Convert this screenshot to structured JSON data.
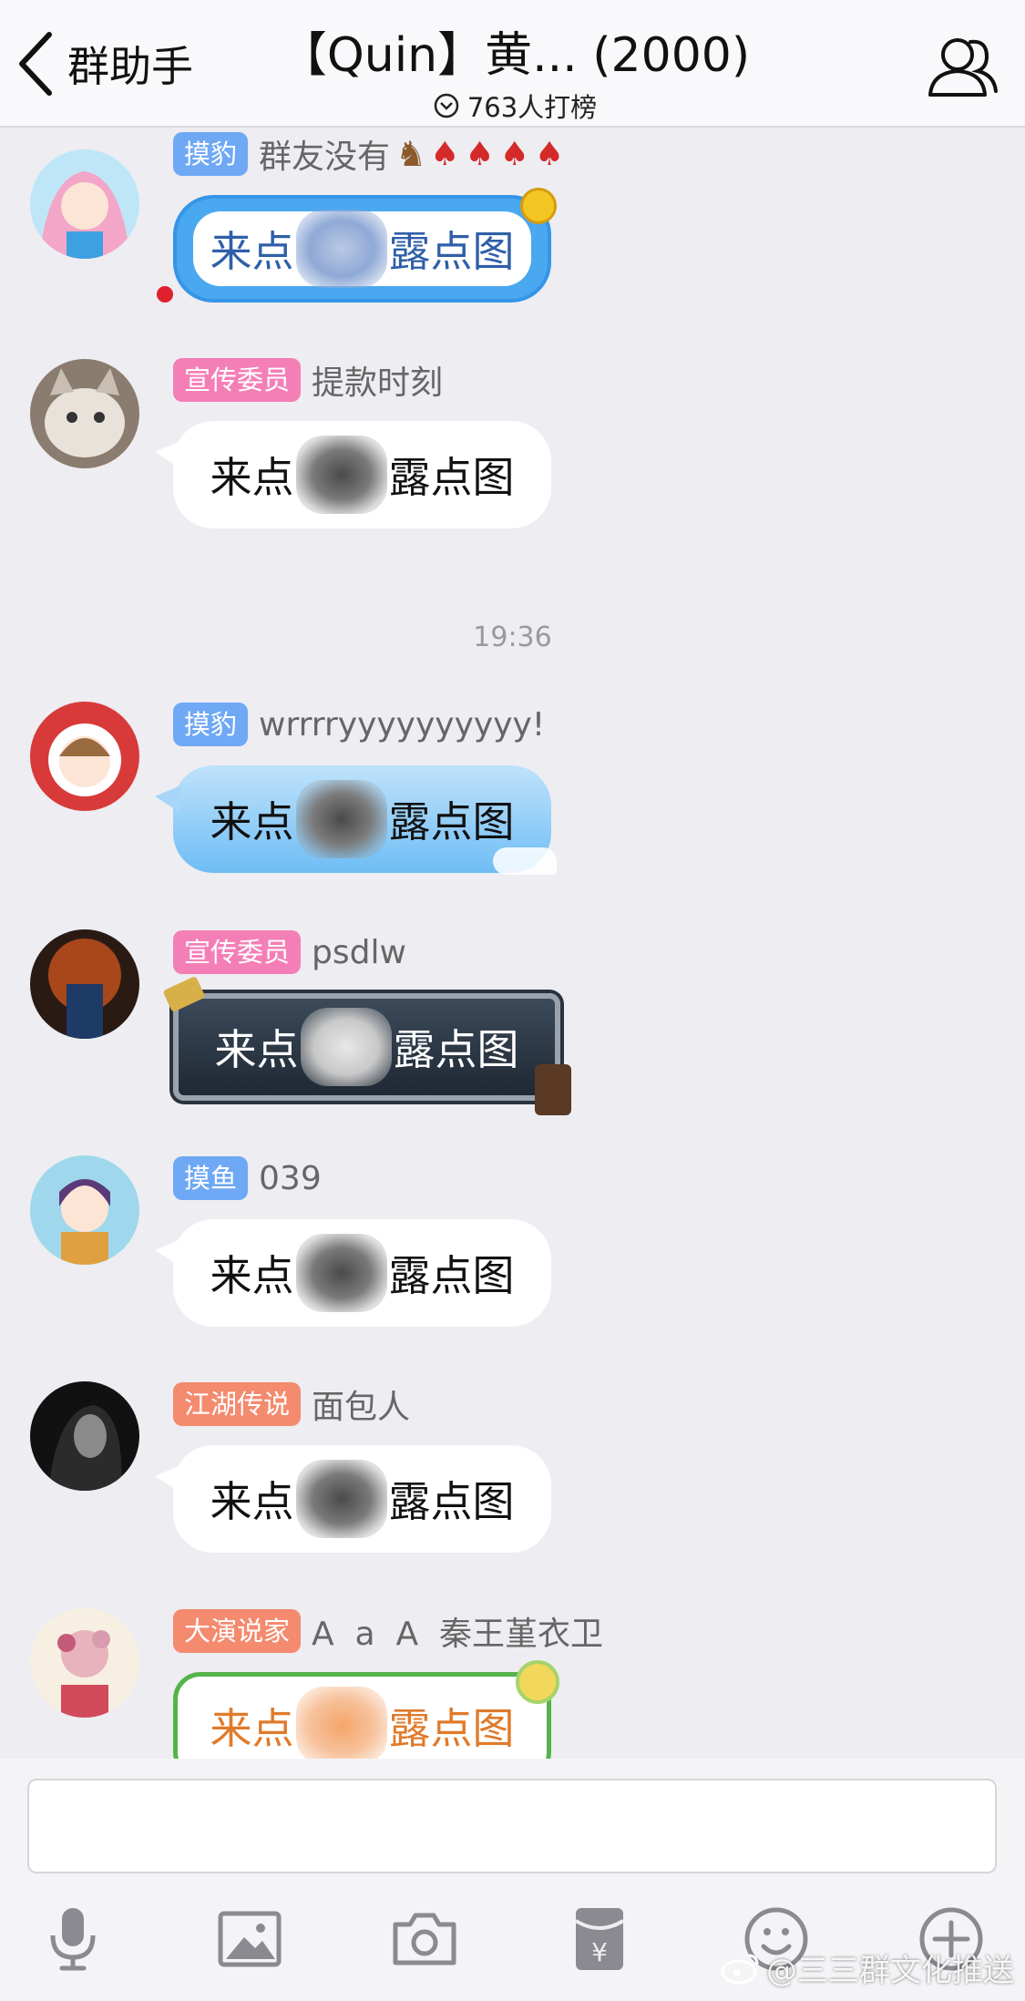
{
  "header": {
    "back_label": "群助手",
    "title": "【Quin】黄... (2000)",
    "subtitle": "763人打榜"
  },
  "chat": {
    "timestamp": "19:36",
    "messages": [
      {
        "badge": "摸豹",
        "badge_color": "#6fa8f5",
        "nick": "群友没有",
        "bubble": {
          "before": "来点",
          "after": "露点图"
        }
      },
      {
        "badge": "宣传委员",
        "badge_color": "#f47fb6",
        "nick": "提款时刻",
        "bubble": {
          "before": "来点",
          "after": "露点图"
        }
      },
      {
        "badge": "摸豹",
        "badge_color": "#6fa8f5",
        "nick": "wrrrryyyyyyyyyy!",
        "bubble": {
          "before": "来点",
          "after": "露点图"
        }
      },
      {
        "badge": "宣传委员",
        "badge_color": "#f47fb6",
        "nick": "psdlw",
        "bubble": {
          "before": "来点",
          "after": "露点图"
        }
      },
      {
        "badge": "摸鱼",
        "badge_color": "#6fa8f5",
        "nick": "039",
        "bubble": {
          "before": "来点",
          "after": "露点图"
        }
      },
      {
        "badge": "江湖传说",
        "badge_color": "#f48a6e",
        "nick": "面包人",
        "bubble": {
          "before": "来点",
          "after": "露点图"
        }
      },
      {
        "badge": "大演说家",
        "badge_color": "#f48a6e",
        "nick": "A  a  A  秦王堇衣卫",
        "bubble": {
          "before": "来点",
          "after": "露点图"
        }
      }
    ]
  },
  "input": {
    "value": "",
    "placeholder": ""
  },
  "toolbar": {
    "icons": [
      "microphone-icon",
      "image-icon",
      "camera-icon",
      "red-packet-icon",
      "emoji-icon",
      "plus-icon"
    ]
  },
  "watermark": "@三三群文化推送"
}
